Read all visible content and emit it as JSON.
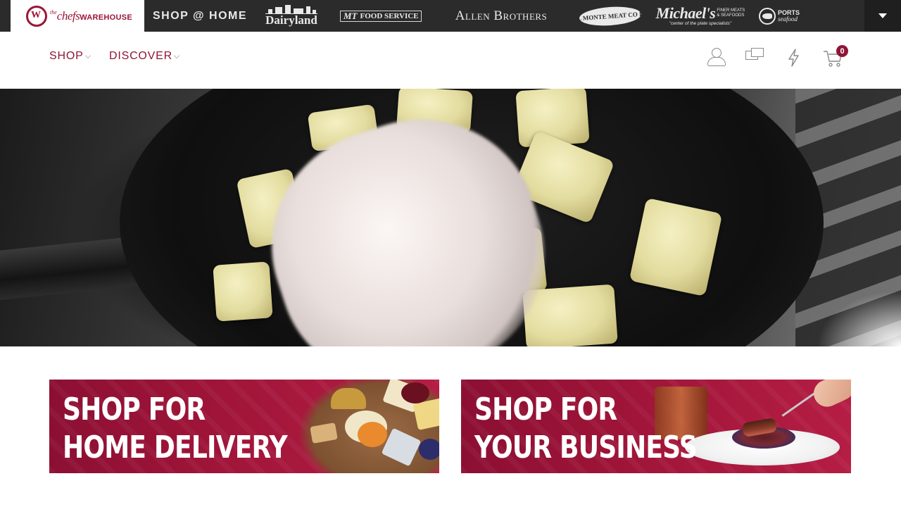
{
  "brand_bar": {
    "main_brand": {
      "the": "the",
      "chefs": "chefs",
      "warehouse": "WAREHOUSE",
      "mark": "W"
    },
    "brands": [
      {
        "label": "SHOP @ HOME"
      },
      {
        "label": "Dairyland"
      },
      {
        "label": "MT FOOD SERVICE",
        "mark": "MT",
        "text": "FOOD SERVICE"
      },
      {
        "label": "Allen Brothers"
      },
      {
        "label": "DEL MONTE MEAT CO LLC"
      },
      {
        "label": "Michael's",
        "sub": "FINER MEATS & SEAFOODS",
        "tagline": "\"center of the plate specialists\""
      },
      {
        "label": "PORTS",
        "sub": "seafood"
      }
    ],
    "dropdown_icon": "caret-down-icon"
  },
  "nav": {
    "items": [
      {
        "label": "SHOP"
      },
      {
        "label": "DISCOVER"
      }
    ],
    "icons": [
      "user-icon",
      "chat-icon",
      "flash-icon",
      "cart-icon"
    ],
    "cart_count": "0"
  },
  "hero": {
    "image": "chef-hand-placing-gnocchi-in-cast-iron-pan"
  },
  "promos": [
    {
      "title": "SHOP FOR\nHOME DELIVERY",
      "image": "cheese-board"
    },
    {
      "title": "SHOP FOR\nYOUR BUSINESS",
      "image": "plated-steak-dish"
    }
  ],
  "colors": {
    "brand_red": "#8f1537",
    "brand_bar_bg": "#2b2b2b",
    "banner_red": "#a01539"
  }
}
